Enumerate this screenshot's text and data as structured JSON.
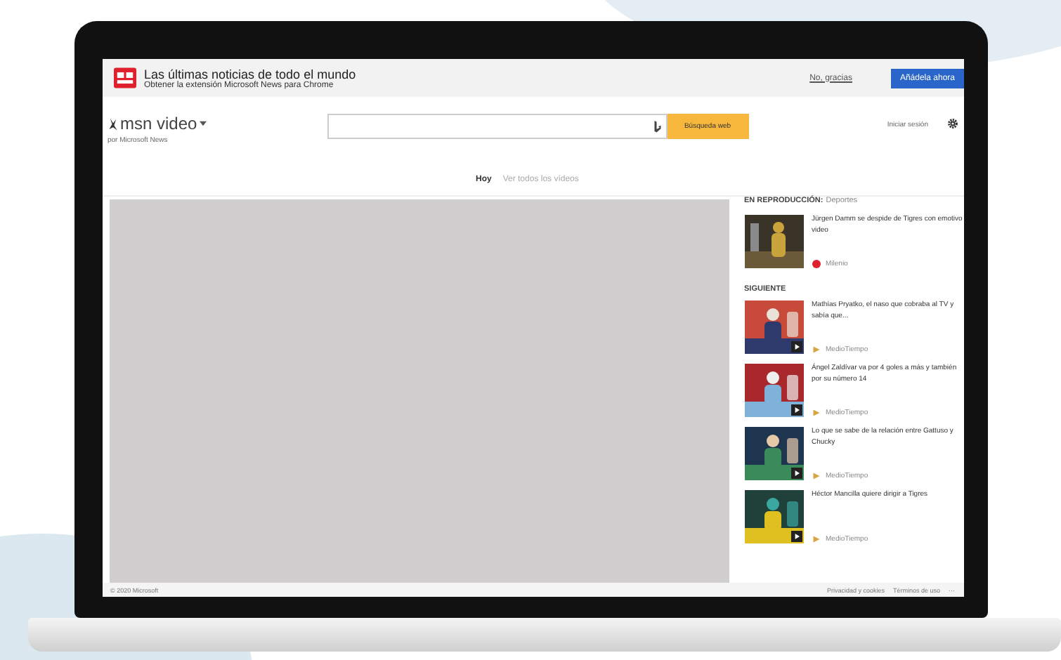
{
  "banner": {
    "title": "Las últimas noticias de todo el mundo",
    "subtitle": "Obtener la extensión Microsoft News para Chrome",
    "decline_link": "No, gracias",
    "accept_button": "Añádela ahora"
  },
  "header": {
    "logo_text": "msn video",
    "byline": "por Microsoft News",
    "search_button": "Búsqueda web",
    "sign_in": "Iniciar sesión"
  },
  "tabs": [
    {
      "label": "Hoy",
      "selected": true
    },
    {
      "label": "Ver todos los vídeos",
      "selected": false
    }
  ],
  "sidebar": {
    "now_playing_label": "EN REPRODUCCIÓN:",
    "now_playing_category": "Deportes",
    "now_playing": {
      "title": "Jürgen Damm se despide de Tigres con emotivo video",
      "source": "Milenio",
      "color": "#e0202c"
    },
    "next_label": "SIGUIENTE",
    "items": [
      {
        "title": "Mathías Pryatko, el naso que cobraba al TV y sabía que...",
        "source": "MedioTiempo",
        "color": "#d9a441"
      },
      {
        "title": "Ángel Zaldívar va por 4 goles a más y también por su número 14",
        "source": "MedioTiempo",
        "color": "#d9a441"
      },
      {
        "title": "Lo que se sabe de la relación entre Gattuso y Chucky",
        "source": "MedioTiempo",
        "color": "#d9a441"
      },
      {
        "title": "Héctor Mancilla quiere dirigir a Tigres",
        "source": "MedioTiempo",
        "color": "#d9a441"
      }
    ]
  },
  "footer": {
    "copyright": "© 2020 Microsoft",
    "links": [
      "Privacidad y cookies",
      "Términos de uso"
    ],
    "more": "···"
  }
}
